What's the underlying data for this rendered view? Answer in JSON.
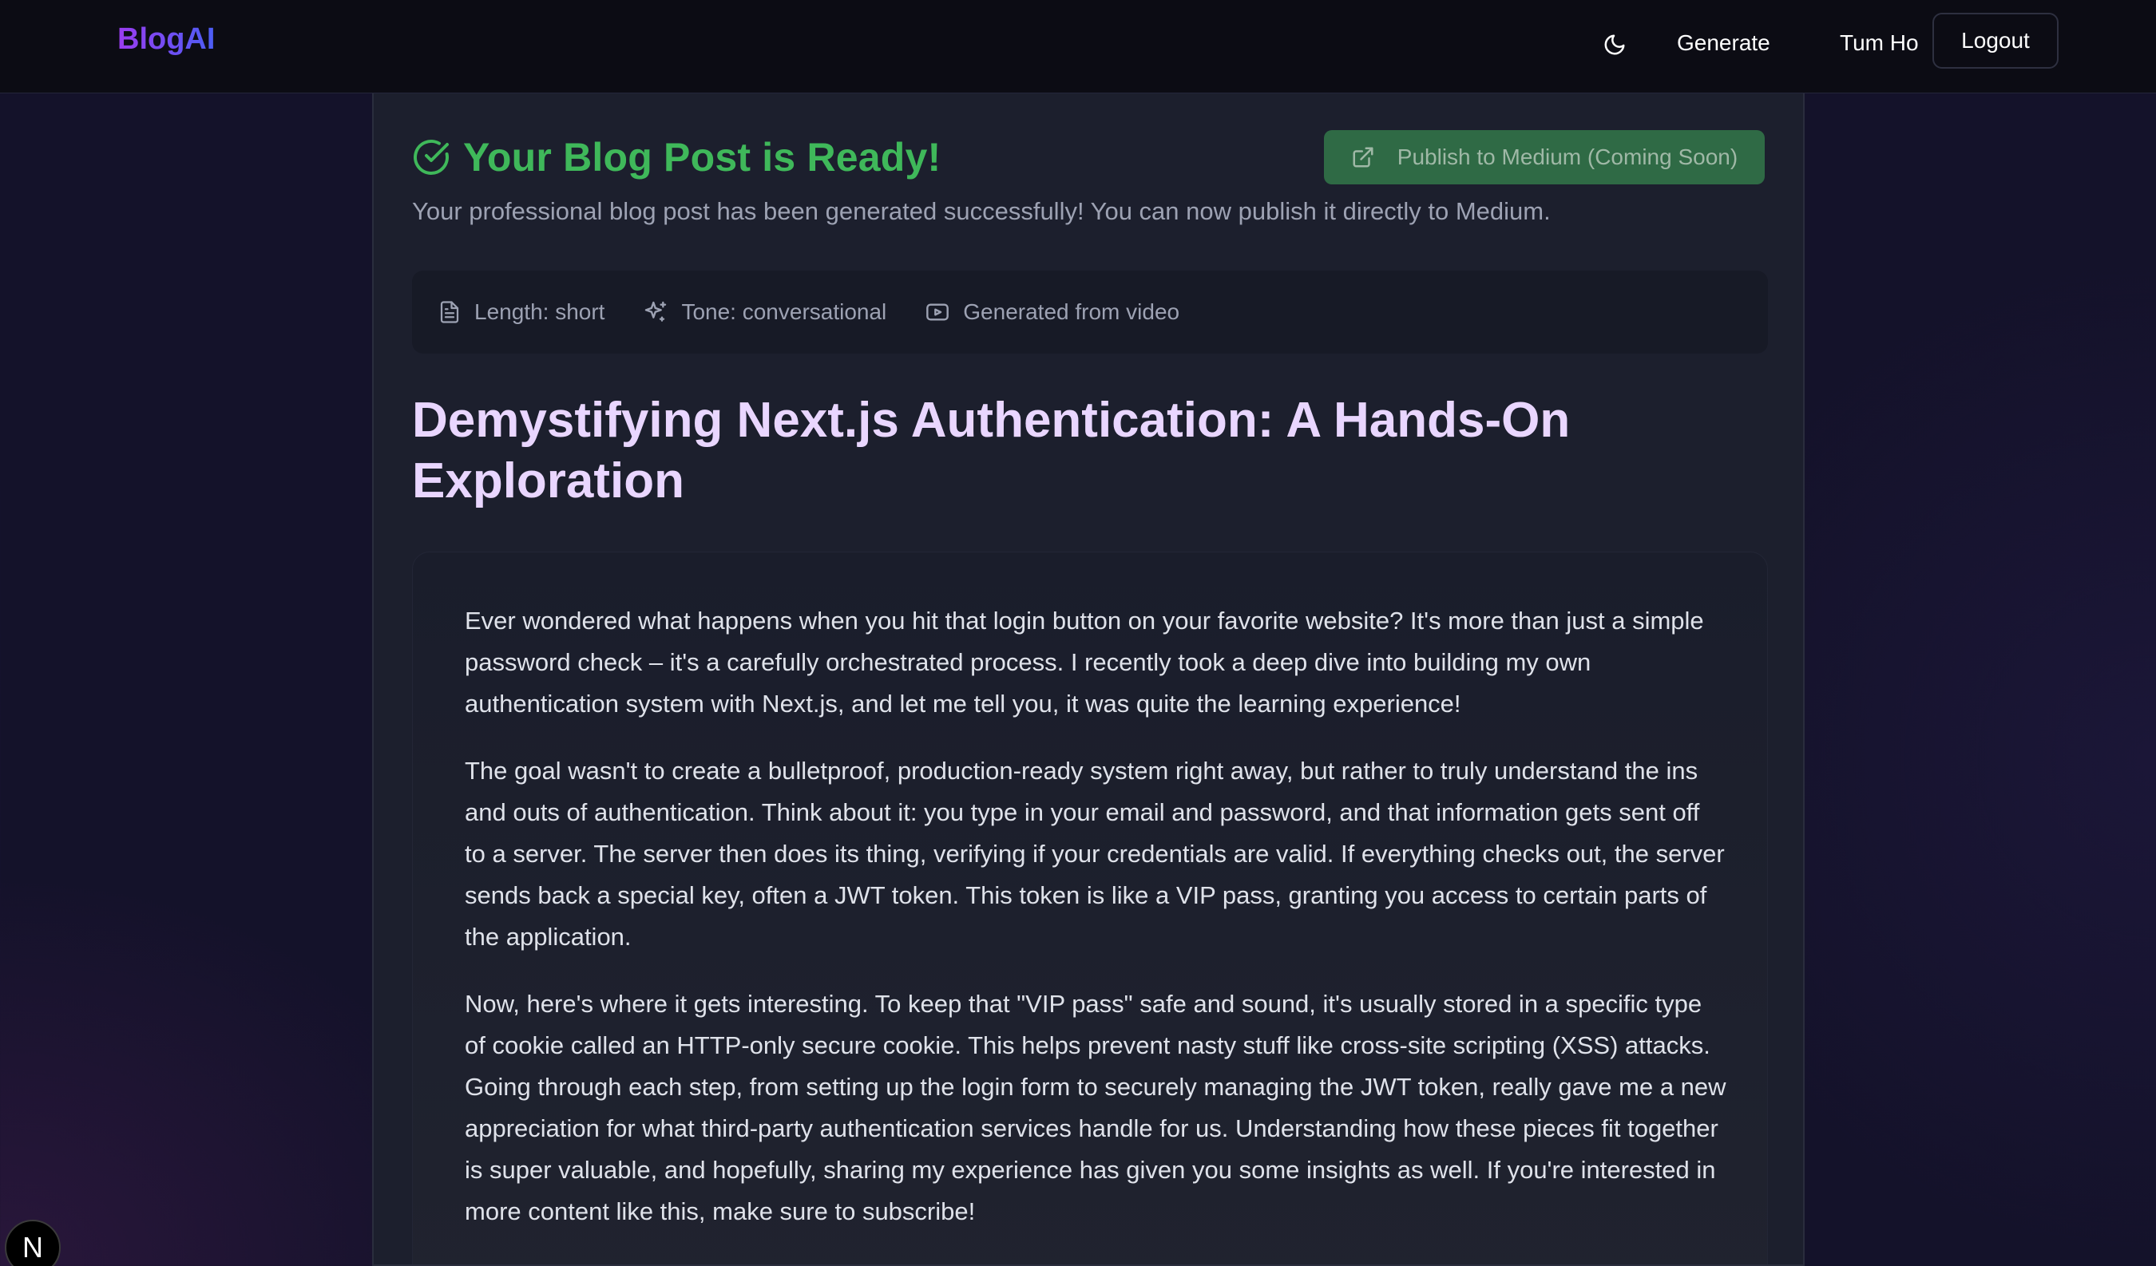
{
  "header": {
    "brand": "BlogAI",
    "theme_toggle_icon": "moon-icon",
    "nav_generate": "Generate",
    "user_name": "Tum Ho",
    "logout_label": "Logout"
  },
  "result": {
    "success_icon": "check-circle-icon",
    "success_title": "Your Blog Post is Ready!",
    "subtitle": "Your professional blog post has been generated successfully! You can now publish it directly to Medium.",
    "publish_icon": "external-link-icon",
    "publish_label": "Publish to Medium (Coming Soon)"
  },
  "meta": {
    "length": "Length: short",
    "tone": "Tone: conversational",
    "source": "Generated from video"
  },
  "post": {
    "title": "Demystifying Next.js Authentication: A Hands-On Exploration",
    "paragraphs": [
      "Ever wondered what happens when you hit that login button on your favorite website? It's more than just a simple password check – it's a carefully orchestrated process. I recently took a deep dive into building my own authentication system with Next.js, and let me tell you, it was quite the learning experience!",
      "The goal wasn't to create a bulletproof, production-ready system right away, but rather to truly understand the ins and outs of authentication. Think about it: you type in your email and password, and that information gets sent off to a server. The server then does its thing, verifying if your credentials are valid. If everything checks out, the server sends back a special key, often a JWT token. This token is like a VIP pass, granting you access to certain parts of the application.",
      "Now, here's where it gets interesting. To keep that \"VIP pass\" safe and sound, it's usually stored in a specific type of cookie called an HTTP-only secure cookie. This helps prevent nasty stuff like cross-site scripting (XSS) attacks. Going through each step, from setting up the login form to securely managing the JWT token, really gave me a new appreciation for what third-party authentication services handle for us. Understanding how these pieces fit together is super valuable, and hopefully, sharing my experience has given you some insights as well. If you're interested in more content like this, make sure to subscribe!"
    ]
  },
  "dev_badge": {
    "label": "N"
  },
  "colors": {
    "success": "#3fb85a",
    "title": "#e9d6ff",
    "publish_bg": "#2f6a45"
  }
}
